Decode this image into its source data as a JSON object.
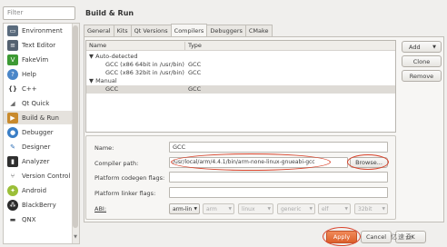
{
  "sidebar": {
    "filter_placeholder": "Filter",
    "items": [
      {
        "label": "Environment",
        "icon": "monitor-icon",
        "color": "#5a6b7d",
        "glyph": "▭"
      },
      {
        "label": "Text Editor",
        "icon": "text-editor-icon",
        "color": "#546170",
        "glyph": "≡"
      },
      {
        "label": "FakeVim",
        "icon": "fakevim-icon",
        "color": "#3d9a34",
        "glyph": "V"
      },
      {
        "label": "Help",
        "icon": "help-icon",
        "color": "#4a86c8",
        "glyph": "?"
      },
      {
        "label": "C++",
        "icon": "cpp-braces-icon",
        "color": "#ffffff",
        "glyph": "{}"
      },
      {
        "label": "Qt Quick",
        "icon": "qt-quick-icon",
        "color": "#ffffff",
        "glyph": "◢"
      },
      {
        "label": "Build & Run",
        "icon": "build-run-icon",
        "color": "#c98a2c",
        "glyph": "▶"
      },
      {
        "label": "Debugger",
        "icon": "debugger-icon",
        "color": "#3a7ec6",
        "glyph": "●"
      },
      {
        "label": "Designer",
        "icon": "designer-icon",
        "color": "#ffffff",
        "glyph": "✎"
      },
      {
        "label": "Analyzer",
        "icon": "analyzer-icon",
        "color": "#2f2f2f",
        "glyph": "▮"
      },
      {
        "label": "Version Control",
        "icon": "version-control-icon",
        "color": "#ffffff",
        "glyph": "⑂"
      },
      {
        "label": "Android",
        "icon": "android-icon",
        "color": "#9bbf38",
        "glyph": "✦"
      },
      {
        "label": "BlackBerry",
        "icon": "blackberry-icon",
        "color": "#2b2b2b",
        "glyph": "⁂"
      },
      {
        "label": "QNX",
        "icon": "qnx-icon",
        "color": "#ffffff",
        "glyph": "▬"
      }
    ]
  },
  "page_title": "Build & Run",
  "tabs": [
    "General",
    "Kits",
    "Qt Versions",
    "Compilers",
    "Debuggers",
    "CMake"
  ],
  "tree": {
    "columns": [
      "Name",
      "Type"
    ],
    "rows": [
      {
        "name": "▼ Auto-detected",
        "type": ""
      },
      {
        "name": "GCC (x86 64bit in /usr/bin)",
        "type": "GCC"
      },
      {
        "name": "GCC (x86 32bit in /usr/bin)",
        "type": "GCC"
      },
      {
        "name": "▼ Manual",
        "type": ""
      },
      {
        "name": "GCC",
        "type": "GCC"
      }
    ]
  },
  "side_buttons": {
    "add": "Add",
    "clone": "Clone",
    "remove": "Remove"
  },
  "details": {
    "name_label": "Name:",
    "name_value": "GCC",
    "compiler_path_label": "Compiler path:",
    "compiler_path_value": "/usr/local/arm/4.4.1/bin/arm-none-linux-gnueabi-gcc",
    "browse_label": "Browse...",
    "codegen_label": "Platform codegen flags:",
    "codegen_value": "",
    "linker_label": "Platform linker flags:",
    "linker_value": "",
    "abi_label": "ABI:",
    "abi_combos": [
      "arm-lin",
      "arm",
      "linux",
      "generic",
      "elf",
      "32bit"
    ]
  },
  "footer": {
    "apply": "Apply",
    "cancel": "Cancel",
    "ok": "OK",
    "watermark": "亿速云"
  },
  "colors": {
    "highlight": "#d9432b",
    "selection": "#dedbd6"
  }
}
